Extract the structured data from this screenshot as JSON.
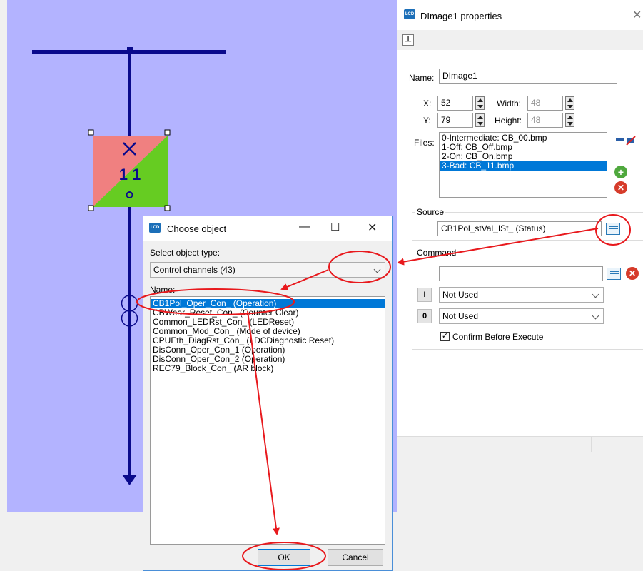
{
  "canvas": {
    "element_label": "1 1",
    "background": "#b3b3ff",
    "line_color": "#0a0a8c",
    "element_colors": {
      "off": "#f08080",
      "on": "#66cc22"
    }
  },
  "properties": {
    "title": "DImage1 properties",
    "pin_icon": "pin-icon",
    "name_label": "Name:",
    "name_value": "DImage1",
    "x_label": "X:",
    "x_value": "52",
    "y_label": "Y:",
    "y_value": "79",
    "width_label": "Width:",
    "width_value": "48",
    "height_label": "Height:",
    "height_value": "48",
    "files_label": "Files:",
    "files": [
      {
        "label": "0-Intermediate: CB_00.bmp",
        "selected": false
      },
      {
        "label": "1-Off: CB_Off.bmp",
        "selected": false
      },
      {
        "label": "2-On: CB_On.bmp",
        "selected": false
      },
      {
        "label": "3-Bad: CB_11.bmp",
        "selected": true
      }
    ],
    "source_label": "Source",
    "source_value": "CB1Pol_stVal_ISt_ (Status)",
    "command_label": "Command",
    "command_value": "",
    "i_label": "I",
    "i_value": "Not Used",
    "o_label": "0",
    "o_value": "Not Used",
    "confirm_label": "Confirm Before Execute",
    "confirm_checked": true
  },
  "dialog": {
    "title": "Choose object",
    "select_type_label": "Select object type:",
    "object_type": "Control channels (43)",
    "name_label": "Name:",
    "items": [
      {
        "label": "CB1Pol_Oper_Con_ (Operation)",
        "selected": true
      },
      {
        "label": "CBWear_Reset_Con_ (Counter Clear)",
        "selected": false
      },
      {
        "label": "Common_LEDRst_Con_ (LEDReset)",
        "selected": false
      },
      {
        "label": "Common_Mod_Con_ (Mode of device)",
        "selected": false
      },
      {
        "label": "CPUEth_DiagRst_Con_ (LDCDiagnostic Reset)",
        "selected": false
      },
      {
        "label": "DisConn_Oper_Con_1 (Operation)",
        "selected": false
      },
      {
        "label": "DisConn_Oper_Con_2 (Operation)",
        "selected": false
      },
      {
        "label": "REC79_Block_Con_ (AR block)",
        "selected": false
      }
    ],
    "ok_label": "OK",
    "cancel_label": "Cancel"
  },
  "annotation_color": "#e8191d",
  "app_icon_text": "LCD"
}
